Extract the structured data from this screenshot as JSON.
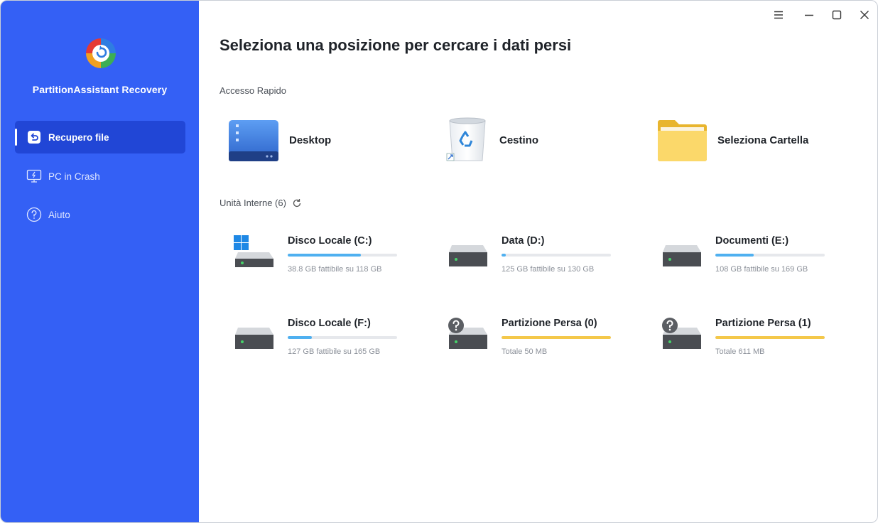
{
  "app": {
    "name": "PartitionAssistant Recovery"
  },
  "sidebar": {
    "items": [
      {
        "label": "Recupero file",
        "icon": "file-recovery-icon",
        "active": true
      },
      {
        "label": "PC in Crash",
        "icon": "monitor-icon",
        "active": false
      },
      {
        "label": "Aiuto",
        "icon": "help-icon",
        "active": false
      }
    ]
  },
  "main": {
    "title": "Seleziona una posizione per cercare i dati persi",
    "quick_access": {
      "label": "Accesso Rapido",
      "items": [
        {
          "label": "Desktop",
          "icon": "desktop-icon"
        },
        {
          "label": "Cestino",
          "icon": "recycle-bin-icon"
        },
        {
          "label": "Seleziona Cartella",
          "icon": "folder-icon"
        }
      ]
    },
    "internal_drives": {
      "label": "Unità Interne (6)",
      "drives": [
        {
          "name": "Disco Locale (C:)",
          "caption": "38.8 GB fattibile su 118 GB",
          "used_fraction": 0.67,
          "type": "system"
        },
        {
          "name": "Data (D:)",
          "caption": "125 GB fattibile su 130 GB",
          "used_fraction": 0.04,
          "type": "disk"
        },
        {
          "name": "Documenti (E:)",
          "caption": "108 GB fattibile su 169 GB",
          "used_fraction": 0.35,
          "type": "disk"
        },
        {
          "name": "Disco Locale (F:)",
          "caption": "127 GB fattibile su 165 GB",
          "used_fraction": 0.22,
          "type": "disk"
        },
        {
          "name": "Partizione Persa (0)",
          "caption": "Totale 50 MB",
          "used_fraction": 1.0,
          "type": "lost"
        },
        {
          "name": "Partizione Persa (1)",
          "caption": "Totale 611 MB",
          "used_fraction": 1.0,
          "type": "lost"
        }
      ]
    }
  },
  "colors": {
    "sidebar": "#3460f5",
    "active_nav": "#2146d6",
    "usage_bar": "#4fb0f0",
    "lost_bar": "#f4c84a"
  }
}
